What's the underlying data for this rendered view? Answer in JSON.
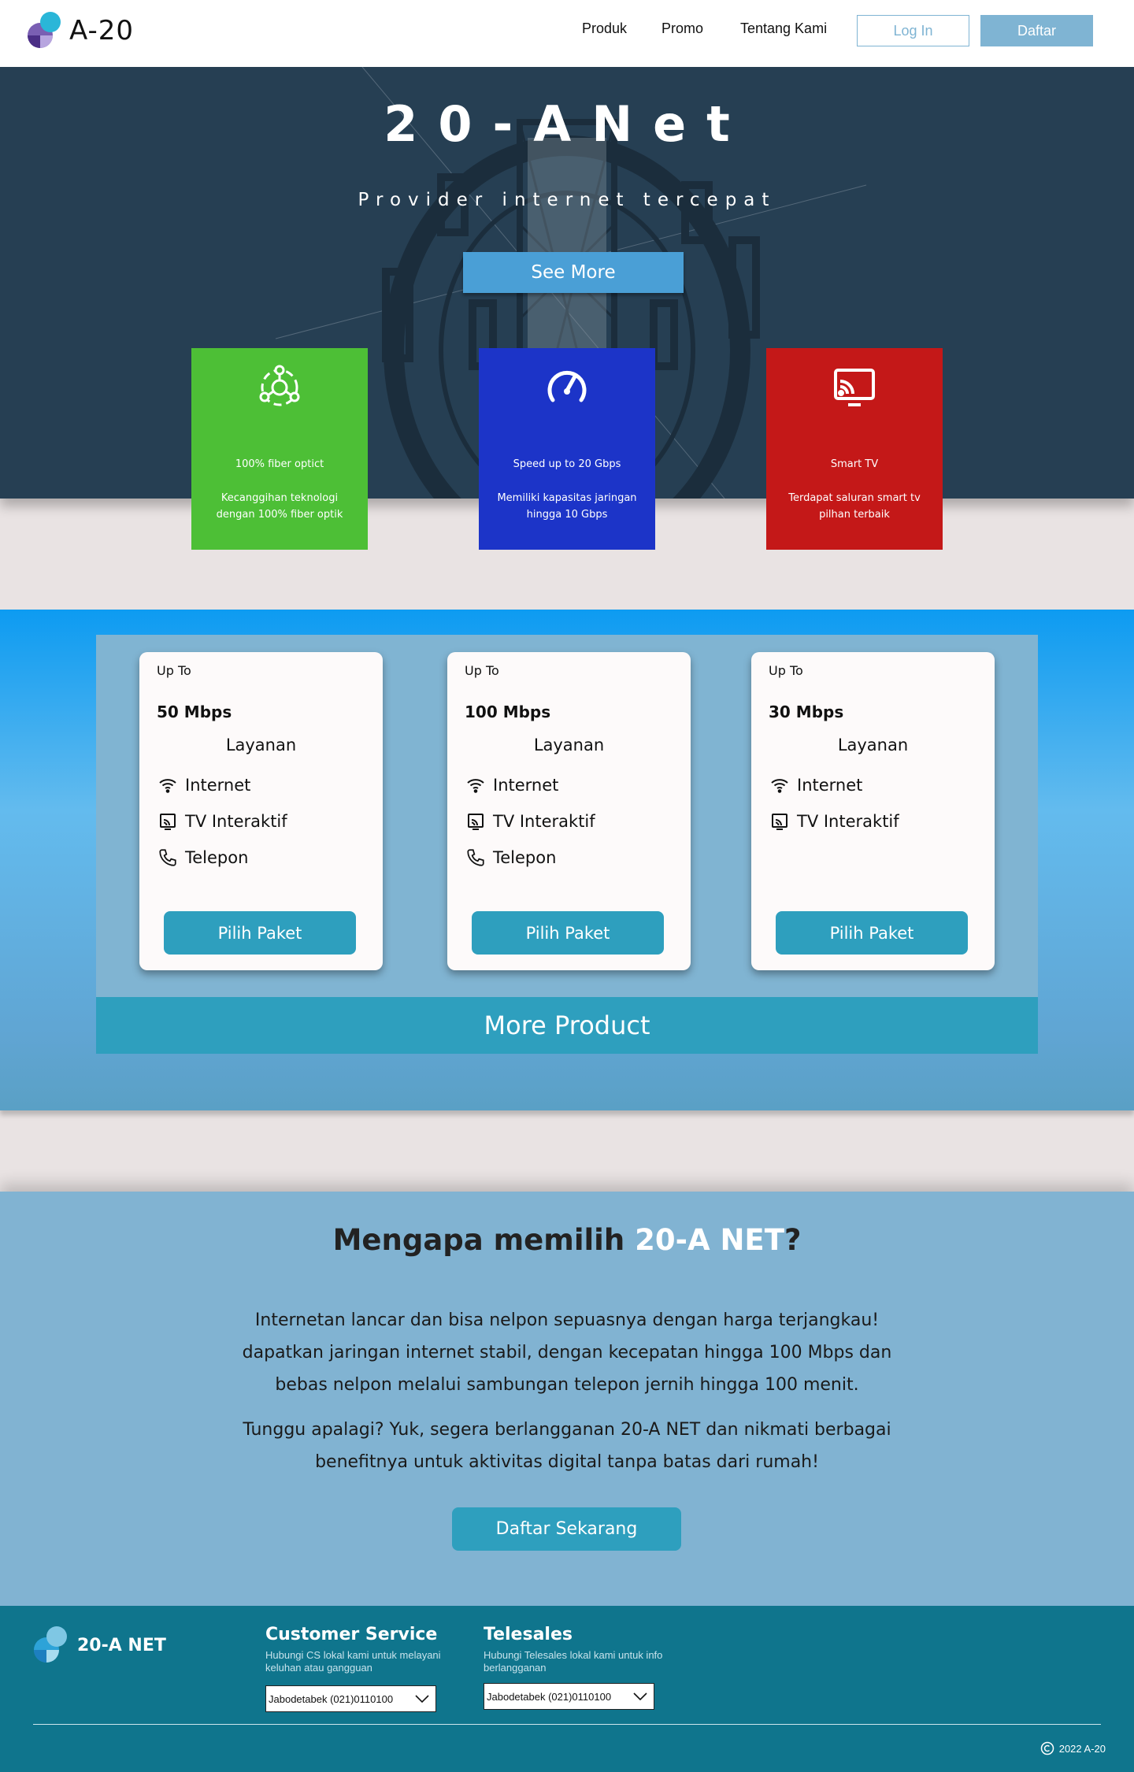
{
  "brand": {
    "name": "A-20"
  },
  "nav": {
    "links": [
      "Produk",
      "Promo",
      "Tentang Kami"
    ],
    "login_label": "Log In",
    "register_label": "Daftar"
  },
  "hero": {
    "title": "20-ANet",
    "subtitle": "Provider internet tercepat",
    "cta_label": "See More"
  },
  "features": [
    {
      "icon": "network-nodes-icon",
      "title": "100% fiber optict",
      "desc": "Kecanggihan teknologi dengan 100% fiber optik",
      "color": "#4dbf36"
    },
    {
      "icon": "speedometer-icon",
      "title": "Speed up to 20 Gbps",
      "desc": "Memiliki kapasitas jaringan hingga 10 Gbps",
      "color": "#1c34c8"
    },
    {
      "icon": "cast-tv-icon",
      "title": "Smart TV",
      "desc": "Terdapat saluran smart tv pilhan terbaik",
      "color": "#c41818"
    }
  ],
  "plans": [
    {
      "upto": "Up To",
      "speed": "50 Mbps",
      "services_label": "Layanan",
      "services": [
        "Internet",
        "TV Interaktif",
        "Telepon"
      ],
      "cta": "Pilih Paket"
    },
    {
      "upto": "Up To",
      "speed": "100 Mbps",
      "services_label": "Layanan",
      "services": [
        "Internet",
        "TV Interaktif",
        "Telepon"
      ],
      "cta": "Pilih Paket"
    },
    {
      "upto": "Up To",
      "speed": "30 Mbps",
      "services_label": "Layanan",
      "services": [
        "Internet",
        "TV Interaktif"
      ],
      "cta": "Pilih Paket"
    }
  ],
  "more_product_label": "More Product",
  "why": {
    "title_prefix": "Mengapa memilih ",
    "title_highlight": "20-A NET",
    "title_suffix": "?",
    "paragraph1": "Internetan lancar dan bisa nelpon sepuasnya dengan harga terjangkau! dapatkan jaringan internet stabil, dengan kecepatan hingga 100 Mbps dan bebas nelpon melalui sambungan telepon jernih hingga 100 menit.",
    "paragraph2": "Tunggu apalagi? Yuk, segera berlangganan 20-A NET dan nikmati berbagai benefitnya untuk aktivitas digital tanpa batas dari rumah!",
    "cta_label": "Daftar Sekarang"
  },
  "footer": {
    "brand": "20-A NET",
    "cs": {
      "title": "Customer Service",
      "desc": "Hubungi CS lokal kami untuk melayani keluhan atau gangguan",
      "selected": "Jabodetabek (021)0110100"
    },
    "telesales": {
      "title": "Telesales",
      "desc": "Hubungi Telesales lokal kami untuk info berlangganan",
      "selected": "Jabodetabek (021)0110100"
    },
    "copyright": "2022 A-20"
  },
  "colors": {
    "accent": "#2e9fbe",
    "nav_button": "#7fb4d3",
    "footer_bg": "#0f758d",
    "hero_bg": "#263f53"
  }
}
